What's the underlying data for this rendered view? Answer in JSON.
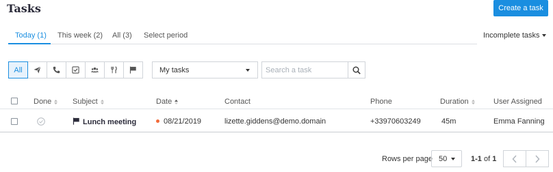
{
  "header": {
    "title": "Tasks",
    "create_label": "Create a task"
  },
  "tabs": [
    {
      "label": "Today (1)",
      "active": true
    },
    {
      "label": "This week (2)",
      "active": false
    },
    {
      "label": "All (3)",
      "active": false
    },
    {
      "label": "Select period",
      "active": false
    }
  ],
  "status_filter": {
    "label": "Incomplete tasks"
  },
  "type_filters": {
    "all_label": "All",
    "icons": [
      "send-icon",
      "phone-icon",
      "checkbox-icon",
      "group-icon",
      "utensils-icon",
      "flag-icon"
    ],
    "active": "All"
  },
  "owner_filter": {
    "value": "My tasks"
  },
  "search": {
    "placeholder": "Search a task"
  },
  "table": {
    "columns": [
      "Done",
      "Subject",
      "Date",
      "Contact",
      "Phone",
      "Duration",
      "User Assigned"
    ],
    "rows": [
      {
        "done": false,
        "subject": "Lunch meeting",
        "subject_icon": "flag-icon",
        "date": "08/21/2019",
        "date_status_color": "#f26b3a",
        "contact": "lizette.giddens@demo.domain",
        "phone": "+33970603249",
        "duration": "45m",
        "user": "Emma Fanning"
      }
    ]
  },
  "pagination": {
    "rows_per_page_label": "Rows per page",
    "rows_per_page": "50",
    "range_start": "1-1",
    "range_of": "of",
    "range_total": "1"
  },
  "colors": {
    "accent": "#1a8ee0",
    "overdue_dot": "#f26b3a"
  }
}
